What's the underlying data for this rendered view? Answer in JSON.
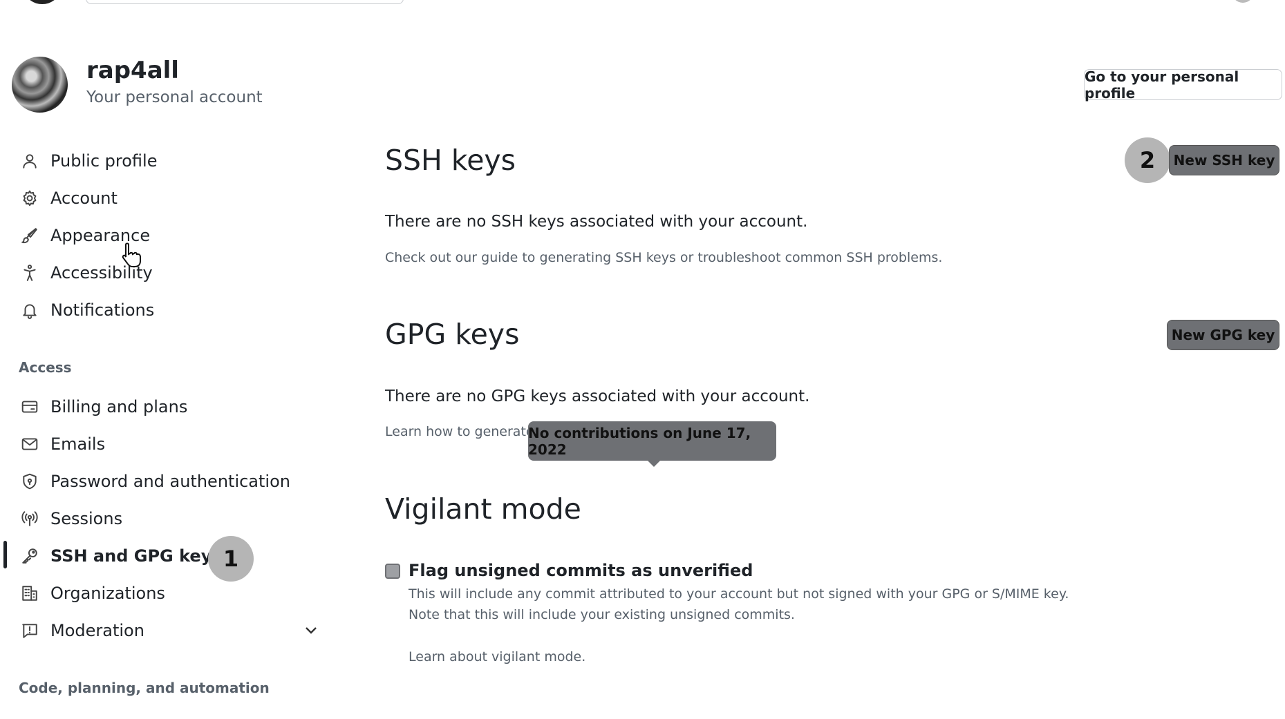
{
  "header": {
    "username": "rap4all",
    "subtitle": "Your personal account",
    "profile_button": "Go to your personal profile"
  },
  "sidebar": {
    "items": [
      {
        "label": "Public profile",
        "icon": "person-icon"
      },
      {
        "label": "Account",
        "icon": "gear-icon"
      },
      {
        "label": "Appearance",
        "icon": "paintbrush-icon"
      },
      {
        "label": "Accessibility",
        "icon": "accessibility-icon"
      },
      {
        "label": "Notifications",
        "icon": "bell-icon"
      }
    ],
    "access_heading": "Access",
    "access_items": [
      {
        "label": "Billing and plans",
        "icon": "credit-card-icon"
      },
      {
        "label": "Emails",
        "icon": "mail-icon"
      },
      {
        "label": "Password and authentication",
        "icon": "shield-lock-icon"
      },
      {
        "label": "Sessions",
        "icon": "broadcast-icon"
      },
      {
        "label": "SSH and GPG keys",
        "icon": "key-icon",
        "active": true
      },
      {
        "label": "Organizations",
        "icon": "organization-icon"
      },
      {
        "label": "Moderation",
        "icon": "report-icon"
      }
    ],
    "code_heading": "Code, planning, and automation"
  },
  "badges": {
    "one": "1",
    "two": "2"
  },
  "ssh": {
    "title": "SSH keys",
    "button": "New SSH key",
    "empty": "There are no SSH keys associated with your account.",
    "help": "Check out our guide to generating SSH keys or troubleshoot common SSH problems."
  },
  "gpg": {
    "title": "GPG keys",
    "button": "New GPG key",
    "empty": "There are no GPG keys associated with your account.",
    "help_partial": "Learn how to generate"
  },
  "tooltip": "No contributions on June 17, 2022",
  "vigilant": {
    "title": "Vigilant mode",
    "checkbox_label": "Flag unsigned commits as unverified",
    "checked": false,
    "note1": "This will include any commit attributed to your account but not signed with your GPG or S/MIME key.",
    "note2": "Note that this will include your existing unsigned commits.",
    "learn": "Learn about vigilant mode."
  },
  "colors": {
    "text": "#1f2328",
    "muted": "#57606a",
    "dark_button": "#6e7074",
    "badge": "#b5b5b5"
  }
}
